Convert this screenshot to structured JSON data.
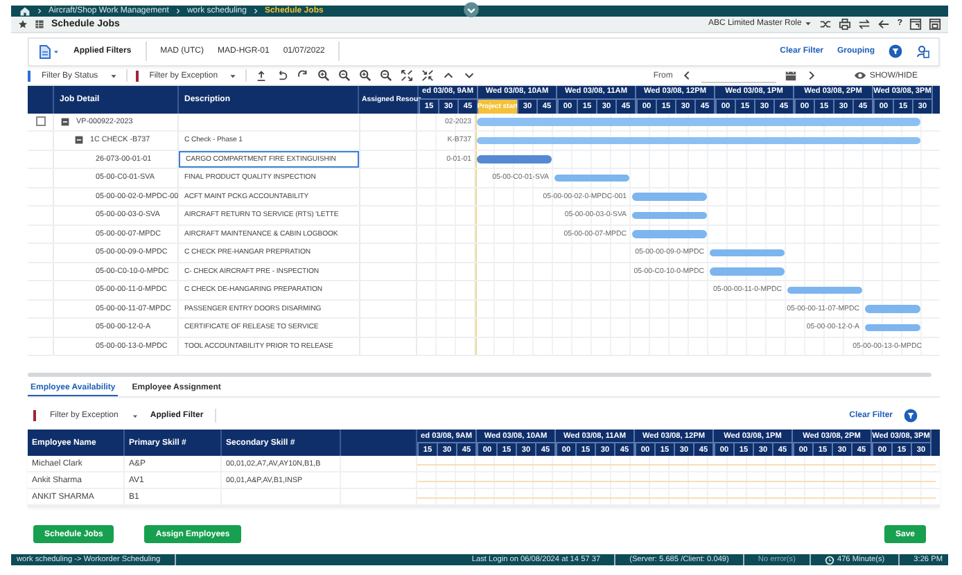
{
  "breadcrumb": [
    {
      "label": "Aircraft/Shop Work Management",
      "current": false
    },
    {
      "label": "work scheduling",
      "current": false
    },
    {
      "label": "Schedule Jobs",
      "current": true
    }
  ],
  "page": {
    "title": "Schedule Jobs",
    "role": "ABC Limited Master Role",
    "help": "?"
  },
  "filters": {
    "title": "Applied Filters",
    "values": [
      "MAD (UTC)",
      "MAD-HGR-01",
      "01/07/2022"
    ],
    "actions": [
      "Clear Filter",
      "Grouping"
    ]
  },
  "toolbar": {
    "dropdowns": [
      {
        "label": "Filter By Status",
        "color": "#2a6fd6"
      },
      {
        "label": "Filter by Exception",
        "color": "#a3243b"
      }
    ],
    "from_label": "From",
    "show_hide": "SHOW/HIDE"
  },
  "gantt": {
    "columns": [
      "Job Detail",
      "Description",
      "Assigned Resour"
    ],
    "hours": [
      {
        "label": "ed 03/08, 9AM",
        "quarters": [
          "15",
          "30",
          "45"
        ]
      },
      {
        "label": "Wed 03/08, 10AM",
        "marker": "Project start",
        "quarters": [
          "30",
          "45"
        ]
      },
      {
        "label": "Wed 03/08, 11AM",
        "quarters": [
          "00",
          "15",
          "30",
          "45"
        ]
      },
      {
        "label": "Wed 03/08, 12PM",
        "quarters": [
          "00",
          "15",
          "30",
          "45"
        ]
      },
      {
        "label": "Wed 03/08, 1PM",
        "quarters": [
          "00",
          "15",
          "30",
          "45"
        ]
      },
      {
        "label": "Wed 03/08, 2PM",
        "quarters": [
          "00",
          "15",
          "30",
          "45"
        ]
      },
      {
        "label": "Wed 03/08, 3PM",
        "quarters": [
          "00",
          "15",
          "30"
        ]
      }
    ],
    "rows": [
      {
        "job": "VP-000922-2023",
        "kind": "group",
        "checked": false,
        "expanded": true,
        "selected": false,
        "bar": {
          "label": "02-2023",
          "scheduled": [
            false,
            true,
            true,
            true,
            true,
            true,
            true
          ]
        },
        "children": [
          {
            "job": "1C CHECK -B737",
            "description": "C Check - Phase 1",
            "kind": "group",
            "expanded": true,
            "selected": false,
            "bar": {
              "label": "K-B737",
              "scheduled": [
                false,
                true,
                true,
                true,
                true,
                true,
                true
              ]
            },
            "children": [
              {
                "job": "26-073-00-01-01",
                "description": "CARGO COMPARTMENT FIRE EXTINGUISHIN",
                "kind": "task",
                "selected": true,
                "bar": {
                  "label": "0-01-01",
                  "scheduled": [
                    false,
                    true,
                    false,
                    false,
                    false,
                    false,
                    false
                  ]
                }
              },
              {
                "job": "05-00-C0-01-SVA",
                "description": "FINAL PRODUCT QUALITY INSPECTION",
                "kind": "task",
                "selected": false,
                "bar": {
                  "label": "05-00-C0-01-SVA",
                  "scheduled": [
                    false,
                    false,
                    true,
                    false,
                    false,
                    false,
                    false
                  ]
                }
              },
              {
                "job": "05-00-00-02-0-MPDC-00",
                "description": "ACFT MAINT PCKG ACCOUNTABILITY",
                "kind": "task",
                "selected": false,
                "bar": {
                  "label": "05-00-00-02-0-MPDC-001",
                  "scheduled": [
                    false,
                    false,
                    false,
                    true,
                    false,
                    false,
                    false
                  ]
                }
              },
              {
                "job": "05-00-00-03-0-SVA",
                "description": "AIRCRAFT RETURN TO SERVICE (RTS) 'LETTE",
                "kind": "task",
                "selected": false,
                "bar": {
                  "label": "05-00-00-03-0-SVA",
                  "scheduled": [
                    false,
                    false,
                    false,
                    true,
                    false,
                    false,
                    false
                  ]
                }
              },
              {
                "job": "05-00-00-07-MPDC",
                "description": "AIRCRAFT MAINTENANCE & CABIN LOGBOOK",
                "kind": "task",
                "selected": false,
                "bar": {
                  "label": "05-00-00-07-MPDC",
                  "scheduled": [
                    false,
                    false,
                    false,
                    true,
                    false,
                    false,
                    false
                  ]
                }
              },
              {
                "job": "05-00-00-09-0-MPDC",
                "description": "C CHECK PRE-HANGAR PREPRATION",
                "kind": "task",
                "selected": false,
                "bar": {
                  "label": "05-00-00-09-0-MPDC",
                  "scheduled": [
                    false,
                    false,
                    false,
                    false,
                    true,
                    false,
                    false
                  ]
                }
              },
              {
                "job": "05-00-C0-10-0-MPDC",
                "description": "C- CHECK AIRCRAFT PRE - INSPECTION",
                "kind": "task",
                "selected": false,
                "bar": {
                  "label": "05-00-C0-10-0-MPDC",
                  "scheduled": [
                    false,
                    false,
                    false,
                    false,
                    true,
                    false,
                    false
                  ]
                }
              },
              {
                "job": "05-00-00-11-0-MPDC",
                "description": "C CHECK DE-HANGARING PREPARATION",
                "kind": "task",
                "selected": false,
                "bar": {
                  "label": "05-00-00-11-0-MPDC",
                  "scheduled": [
                    false,
                    false,
                    false,
                    false,
                    false,
                    true,
                    false
                  ]
                }
              },
              {
                "job": "05-00-00-11-07-MPDC",
                "description": "PASSENGER ENTRY DOORS DISARMING",
                "kind": "task",
                "selected": false,
                "bar": {
                  "label": "05-00-00-11-07-MPDC",
                  "scheduled": [
                    false,
                    false,
                    false,
                    false,
                    false,
                    false,
                    true
                  ]
                }
              },
              {
                "job": "05-00-00-12-0-A",
                "description": "CERTIFICATE OF RELEASE TO SERVICE",
                "kind": "task",
                "selected": false,
                "bar": {
                  "label": "05-00-00-12-0-A",
                  "scheduled": [
                    false,
                    false,
                    false,
                    false,
                    false,
                    false,
                    true
                  ]
                }
              },
              {
                "job": "05-00-00-13-0-MPDC",
                "description": "TOOL ACCOUNTABILITY PRIOR TO RELEASE",
                "kind": "task",
                "selected": false,
                "bar": {
                  "label": "05-00-00-13-0-MPDC",
                  "scheduled": [
                    false,
                    false,
                    false,
                    false,
                    false,
                    false,
                    false
                  ]
                }
              }
            ]
          }
        ]
      }
    ]
  },
  "employees": {
    "tabs": [
      {
        "label": "Employee Availability",
        "selected": true
      },
      {
        "label": "Employee Assignment",
        "selected": false
      }
    ],
    "filter": {
      "label": "Filter by Exception",
      "color": "#a3243b"
    },
    "applied": "Applied Filter",
    "clear": "Clear Filter",
    "columns": [
      "Employee Name",
      "Primary Skill #",
      "Secondary Skill #"
    ],
    "hours": [
      {
        "label": "ed 03/08, 9AM",
        "quarters": [
          "15",
          "30",
          "45"
        ]
      },
      {
        "label": "Wed 03/08, 10AM",
        "quarters": [
          "00",
          "15",
          "30",
          "45"
        ]
      },
      {
        "label": "Wed 03/08, 11AM",
        "quarters": [
          "00",
          "15",
          "30",
          "45"
        ]
      },
      {
        "label": "Wed 03/08, 12PM",
        "quarters": [
          "00",
          "15",
          "30",
          "45"
        ]
      },
      {
        "label": "Wed 03/08, 1PM",
        "quarters": [
          "00",
          "15",
          "30",
          "45"
        ]
      },
      {
        "label": "Wed 03/08, 2PM",
        "quarters": [
          "00",
          "15",
          "30",
          "45"
        ]
      },
      {
        "label": "Wed 03/08, 3PM",
        "quarters": [
          "00",
          "15",
          "30"
        ]
      }
    ],
    "rows": [
      {
        "name": "Michael Clark",
        "primary": "A&P",
        "secondary": "00,01,02,A7,AV,AY10N,B1,B"
      },
      {
        "name": "Ankit Sharma",
        "primary": "AV1",
        "secondary": "00,01,A&P,AV,B1,INSP"
      },
      {
        "name": "ANKIT SHARMA",
        "primary": "B1"
      }
    ]
  },
  "buttons": [
    "Schedule Jobs",
    "Assign Employees"
  ],
  "save": "Save",
  "status_bar": {
    "path": "work scheduling -> Workorder Scheduling",
    "login": "Last Login on 06/08/2024 at 14 57 37",
    "server": "(Server: 5.685 /Client: 0.049)",
    "errors": "No error(s)",
    "session": "476 Minute(s)",
    "time": "3:26 PM"
  }
}
